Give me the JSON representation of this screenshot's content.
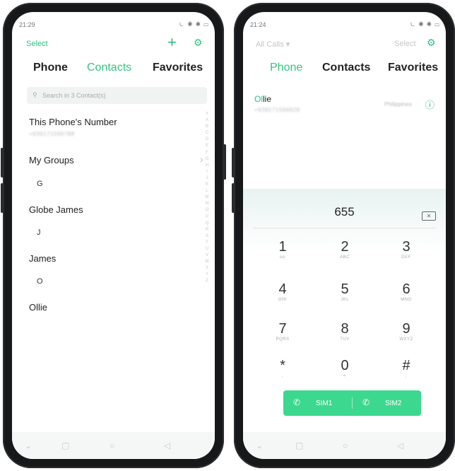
{
  "left": {
    "status_time": "21:29",
    "status_icons": "⏾ ◉ ✱ ▭",
    "select_label": "Select",
    "add_icon": "+",
    "settings_icon": "⚙",
    "tabs": [
      "Phone",
      "Contacts",
      "Favorites"
    ],
    "search_placeholder": "Search in 3 Contact(s)",
    "my_number_title": "This Phone's Number",
    "my_number_value": "+639171566788",
    "my_groups": "My Groups",
    "groups": [
      {
        "letter": "G",
        "name": "Globe James"
      },
      {
        "letter": "J",
        "name": "James"
      },
      {
        "letter": "O",
        "name": "Ollie"
      }
    ],
    "alphabet": "#ABCDEFGHIJKLMNOPQRSTUVWXYZ"
  },
  "right": {
    "status_time": "21:24",
    "status_icons": "⏾ ◉ ✱ ▭",
    "filter_label": "All Calls ▾",
    "select_label": "Select",
    "tabs": [
      "Phone",
      "Contacts",
      "Favorites"
    ],
    "result_name_highlight": "Ol",
    "result_name_rest": "lie",
    "result_number": "+639171566628",
    "result_location": "Philippines",
    "dial_value": "655",
    "keys": [
      {
        "d": "1",
        "l": "ᴏᴏ"
      },
      {
        "d": "2",
        "l": "ABC"
      },
      {
        "d": "3",
        "l": "DEF"
      },
      {
        "d": "4",
        "l": "GHI"
      },
      {
        "d": "5",
        "l": "JKL"
      },
      {
        "d": "6",
        "l": "MNO"
      },
      {
        "d": "7",
        "l": "PQRS"
      },
      {
        "d": "8",
        "l": "TUV"
      },
      {
        "d": "9",
        "l": "WXYZ"
      },
      {
        "d": "*",
        "l": ","
      },
      {
        "d": "0",
        "l": "+"
      },
      {
        "d": "#",
        "l": ";"
      }
    ],
    "sim1": "SIM1",
    "sim2": "SIM2"
  },
  "nav_icons": [
    "chevron-down-icon",
    "square-icon",
    "circle-icon",
    "triangle-back-icon"
  ],
  "colors": {
    "accent": "#36c47f",
    "call_bar": "#3dd88f",
    "frame": "#17181a"
  }
}
